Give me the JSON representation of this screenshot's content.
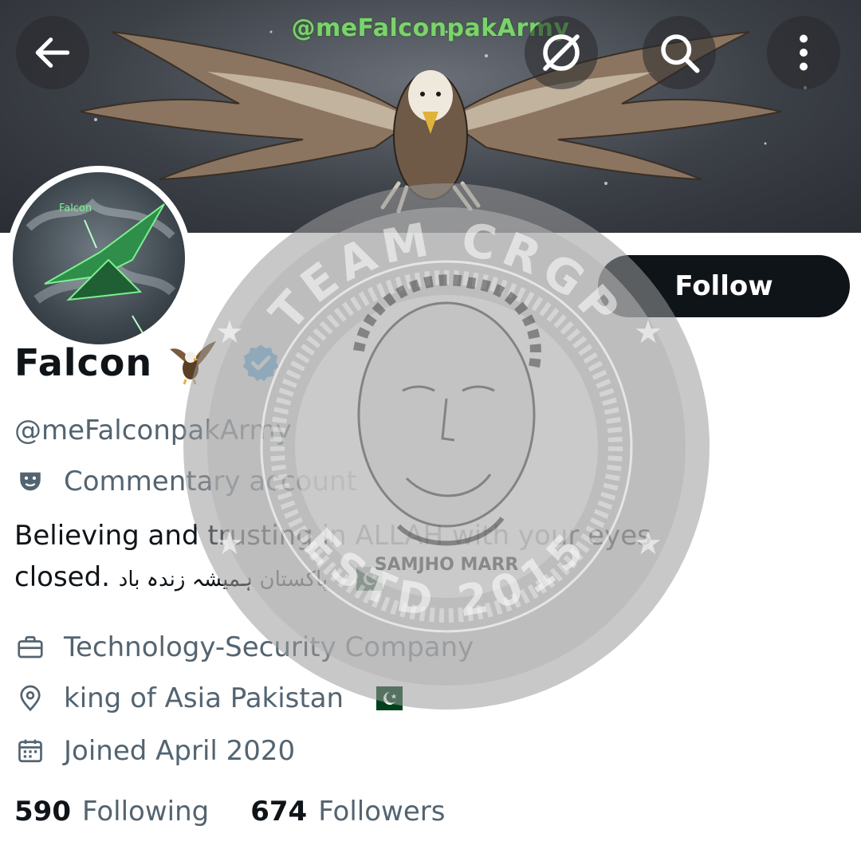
{
  "banner": {
    "handle_text": "@meFalconpakArmy"
  },
  "topbar": {
    "back_icon": "arrow-left-icon",
    "grok_icon": "grok-icon",
    "search_icon": "search-icon",
    "more_icon": "more-vertical-icon"
  },
  "avatar": {
    "caption": "Falcon"
  },
  "follow_label": "Follow",
  "profile": {
    "name": "Falcon",
    "name_emoji": "eagle",
    "verified": true,
    "handle": "@meFalconpakArmy",
    "label": "Commentary account",
    "bio_line1": "Believing and trusting in ALLAH with your eyes",
    "bio_line2_prefix": "closed. ",
    "bio_urdu": "پاکستان ہمیشہ زندہ باد",
    "category": "Technology-Security Company",
    "location": "king of Asia Pakistan",
    "joined": "Joined April 2020"
  },
  "stats": {
    "following_count": "590",
    "following_label": "Following",
    "followers_count": "674",
    "followers_label": "Followers"
  },
  "watermark": {
    "top_text": "TEAM CRGP",
    "bottom_text": "ESTD 2015",
    "mid_text": "SAMJHO MARR"
  },
  "colors": {
    "primary_text": "#0f1419",
    "secondary_text": "#536471",
    "verified_blue": "#1d9bf0",
    "banner_handle_green": "#7bd36b",
    "pakistan_green": "#01411c"
  }
}
